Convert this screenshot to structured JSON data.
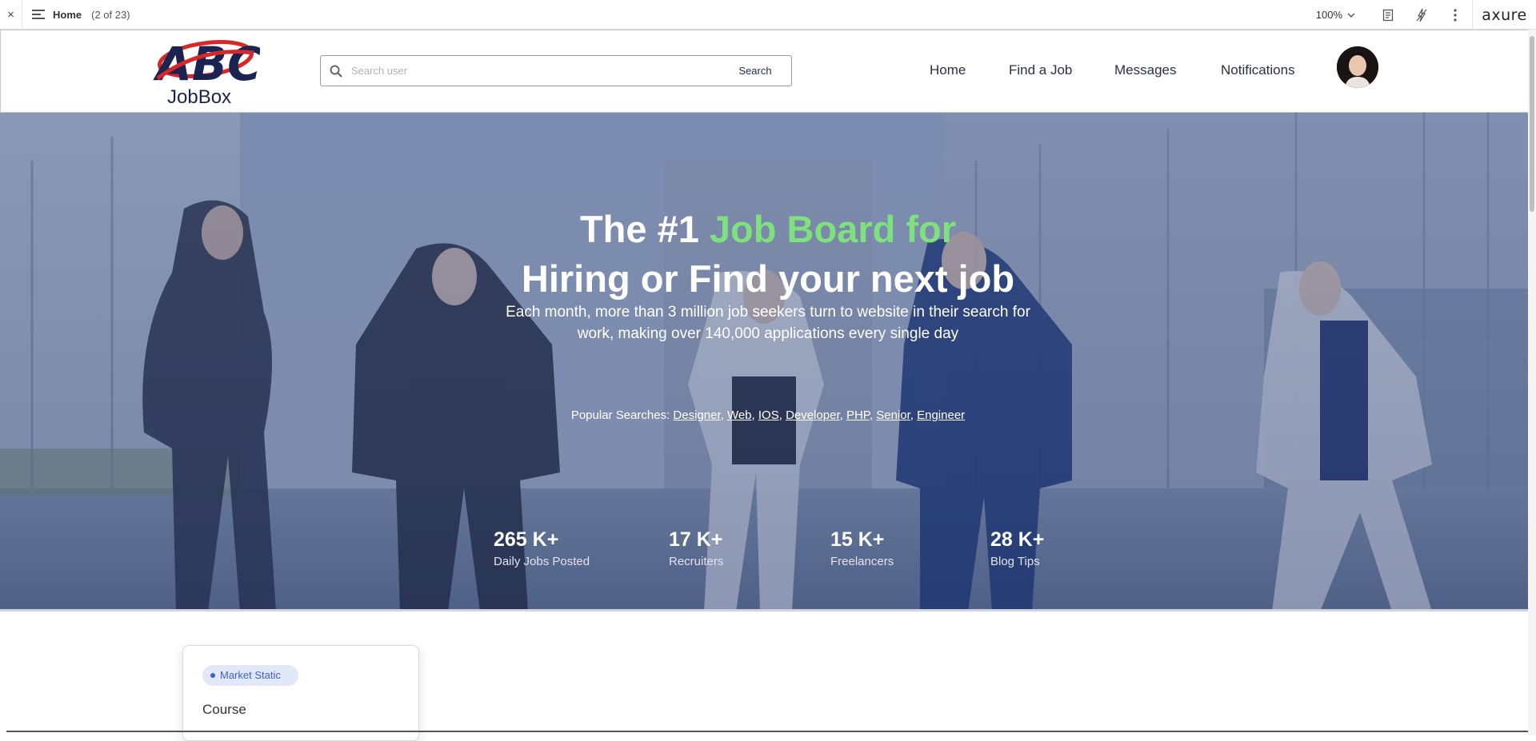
{
  "axure": {
    "close_glyph": "×",
    "page_name": "Home",
    "page_count": "(2 of 23)",
    "zoom": "100%",
    "logo": "axure"
  },
  "header": {
    "brand_name": "JobBox",
    "search_placeholder": "Search user",
    "search_button": "Search",
    "nav": [
      "Home",
      "Find a Job",
      "Messages",
      "Notifications"
    ]
  },
  "hero": {
    "title_part1": "The #1 ",
    "title_accent": "Job Board for",
    "title_line2": "Hiring or Find your next job",
    "lead_line1": "Each month, more than 3 million job seekers turn to website in their search for",
    "lead_line2": "work, making over 140,000 applications every single day",
    "popular_label": "Popular Searches: ",
    "popular_items": [
      "Designer",
      "Web",
      "IOS",
      "Developer",
      "PHP",
      "Senior",
      "Engineer"
    ],
    "accent_color": "#7fe07f",
    "stats": [
      {
        "value": "265 K+",
        "label": "Daily Jobs Posted"
      },
      {
        "value": "17 K+",
        "label": "Recruiters"
      },
      {
        "value": "15 K+",
        "label": "Freelancers"
      },
      {
        "value": "28 K+",
        "label": "Blog Tips"
      }
    ]
  },
  "section": {
    "badge": "Market Static",
    "card_title": "Course"
  }
}
